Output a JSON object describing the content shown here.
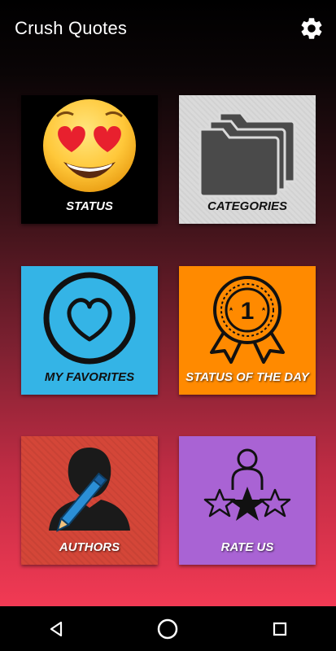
{
  "app": {
    "title": "Crush Quotes"
  },
  "tiles": [
    {
      "id": "status",
      "label": "STATUS",
      "icon": "heart-eyes-emoji-icon",
      "color": "#000000"
    },
    {
      "id": "categories",
      "label": "CATEGORIES",
      "icon": "folders-icon",
      "color": "#dadada"
    },
    {
      "id": "favorites",
      "label": "MY FAVORITES",
      "icon": "heart-circle-icon",
      "color": "#34b4e6"
    },
    {
      "id": "status_of_day",
      "label": "STATUS OF THE DAY",
      "icon": "award-ribbon-icon",
      "color": "#ff8a00"
    },
    {
      "id": "authors",
      "label": "AUTHORS",
      "icon": "author-pen-icon",
      "color": "#d44638"
    },
    {
      "id": "rate_us",
      "label": "RATE US",
      "icon": "rating-stars-icon",
      "color": "#a963d4"
    }
  ],
  "badge": {
    "number": "1"
  },
  "icons": {
    "settings": "gear-icon",
    "nav_back": "back-triangle-icon",
    "nav_home": "home-circle-icon",
    "nav_recents": "recents-square-icon"
  }
}
